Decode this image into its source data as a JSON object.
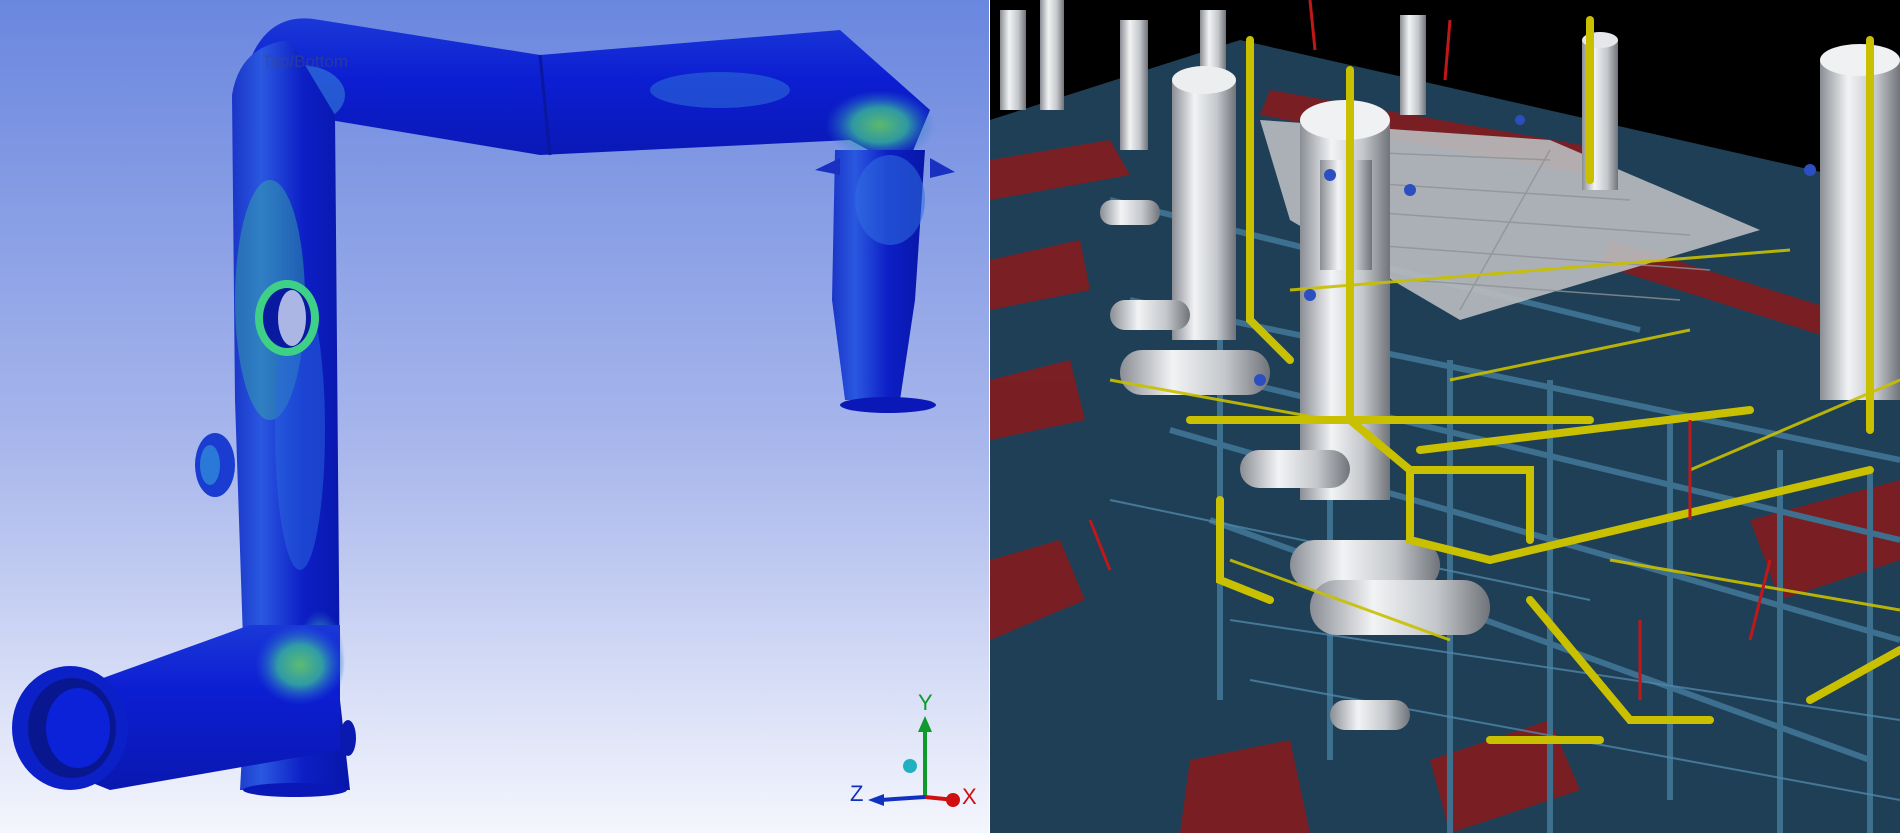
{
  "left_view": {
    "view_label": "Top/Bottom",
    "triad": {
      "x_label": "X",
      "y_label": "Y",
      "z_label": "Z"
    },
    "colors": {
      "background_top": "#6d8be0",
      "background_bottom": "#f3f5fc",
      "stress_low": "#0a1fd0",
      "stress_mid": "#2f6fe0",
      "stress_high": "#37d07a",
      "x_axis": "#e01010",
      "y_axis": "#10a030",
      "z_axis": "#1030c0"
    }
  },
  "right_view": {
    "colors": {
      "sky": "#000000",
      "ground": "#1f3f57",
      "steel": "#3d6f8f",
      "pipe": "#c8c000",
      "vessel": "#d9dbde",
      "marker": "#b01818"
    }
  }
}
